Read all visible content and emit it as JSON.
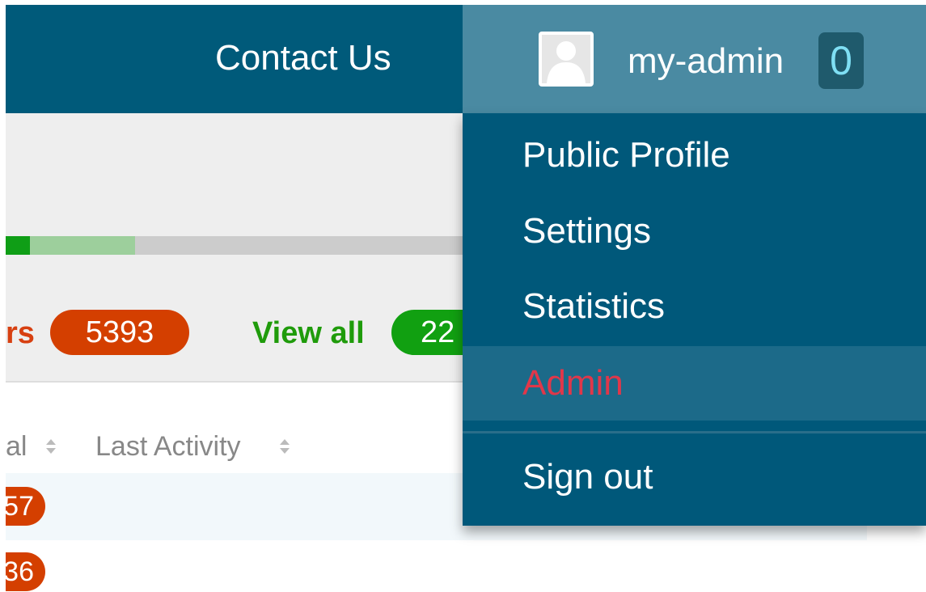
{
  "nav": {
    "contact_label": "Contact Us",
    "username": "my-admin",
    "notification_count": "0"
  },
  "user_menu": {
    "items": [
      {
        "label": "Public Profile"
      },
      {
        "label": "Settings"
      },
      {
        "label": "Statistics"
      },
      {
        "label": "Admin",
        "active": true
      },
      {
        "label": "Sign out"
      }
    ],
    "active_color": "#e0374a"
  },
  "page": {
    "stat_label_fragment": "rs",
    "stat_count": "5393",
    "view_all_label": "View all",
    "view_all_count_fragment": "22",
    "columns": [
      {
        "label_fragment": "al"
      },
      {
        "label": "Last Activity"
      }
    ],
    "rows": [
      {
        "value_fragment": "57"
      },
      {
        "value_fragment": "36"
      }
    ]
  },
  "colors": {
    "header_bg": "#005a7a",
    "user_area_bg": "#4a8aa2",
    "badge_red": "#d43f00",
    "badge_green": "#11a011"
  }
}
